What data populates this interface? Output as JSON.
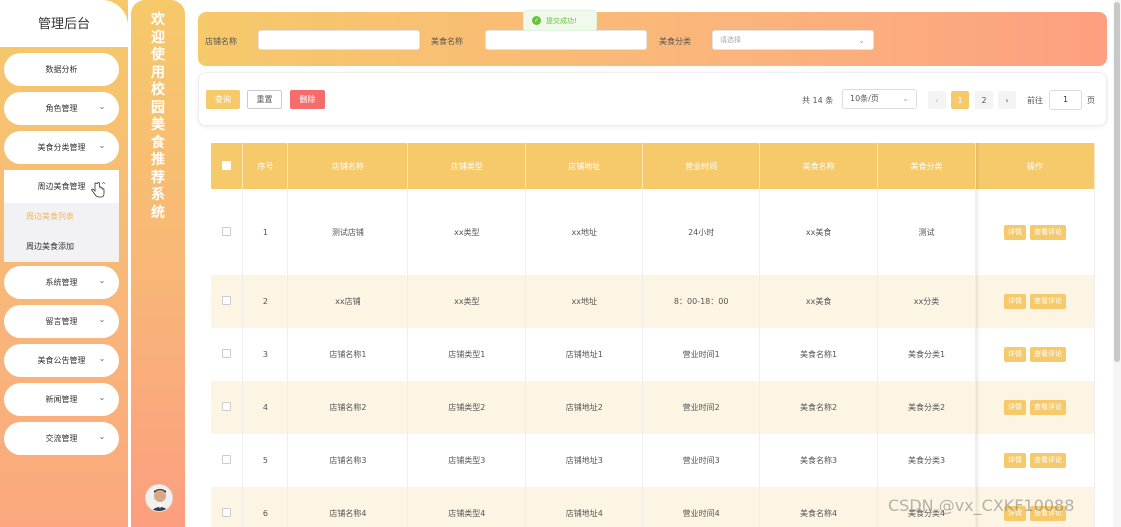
{
  "sidebar": {
    "title": "管理后台",
    "items": [
      {
        "label": "数据分析"
      },
      {
        "label": "角色管理"
      },
      {
        "label": "美食分类管理"
      },
      {
        "label": "系统管理"
      },
      {
        "label": "留言管理"
      },
      {
        "label": "美食公告管理"
      },
      {
        "label": "新闻管理"
      },
      {
        "label": "交流管理"
      }
    ],
    "open_group": {
      "label": "周边美食管理",
      "sub_items": [
        {
          "label": "周边美食列表",
          "active": true
        },
        {
          "label": "周边美食添加",
          "active": false
        }
      ]
    }
  },
  "welcome": {
    "text": "欢迎使用校园美食推荐系统"
  },
  "toast": {
    "text": "提交成功!"
  },
  "search": {
    "shop_name_label": "店铺名称",
    "food_name_label": "美食名称",
    "food_category_label": "美食分类",
    "category_placeholder": "请选择"
  },
  "actions": {
    "query": "查询",
    "reset": "重置",
    "delete": "删除"
  },
  "pagination": {
    "total": "共 14 条",
    "page_size": "10条/页",
    "pages": [
      "1",
      "2"
    ],
    "current_page": "1",
    "goto_label": "前往",
    "goto_value": "1",
    "page_suffix": "页"
  },
  "table": {
    "headers": [
      "序号",
      "店铺名称",
      "店铺类型",
      "店铺地址",
      "营业时间",
      "美食名称",
      "美食分类",
      "操作"
    ],
    "rows": [
      [
        "1",
        "测试店铺",
        "xx类型",
        "xx地址",
        "24小时",
        "xx美食",
        "测试"
      ],
      [
        "2",
        "xx店铺",
        "xx类型",
        "xx地址",
        "8：00-18：00",
        "xx美食",
        "xx分类"
      ],
      [
        "3",
        "店铺名称1",
        "店铺类型1",
        "店铺地址1",
        "营业时间1",
        "美食名称1",
        "美食分类1"
      ],
      [
        "4",
        "店铺名称2",
        "店铺类型2",
        "店铺地址2",
        "营业时间2",
        "美食名称2",
        "美食分类2"
      ],
      [
        "5",
        "店铺名称3",
        "店铺类型3",
        "店铺地址3",
        "营业时间3",
        "美食名称3",
        "美食分类3"
      ],
      [
        "6",
        "店铺名称4",
        "店铺类型4",
        "店铺地址4",
        "营业时间4",
        "美食名称4",
        "美食分类4"
      ]
    ],
    "row_actions": {
      "detail": "详情",
      "review": "查看评论"
    }
  },
  "watermark": {
    "text": "CSDN @vx_CXKF10088"
  },
  "colors": {
    "accent": "#f6c96a",
    "gradient_end": "#fd9f80",
    "danger": "#f56c6c",
    "success": "#67c23a"
  }
}
